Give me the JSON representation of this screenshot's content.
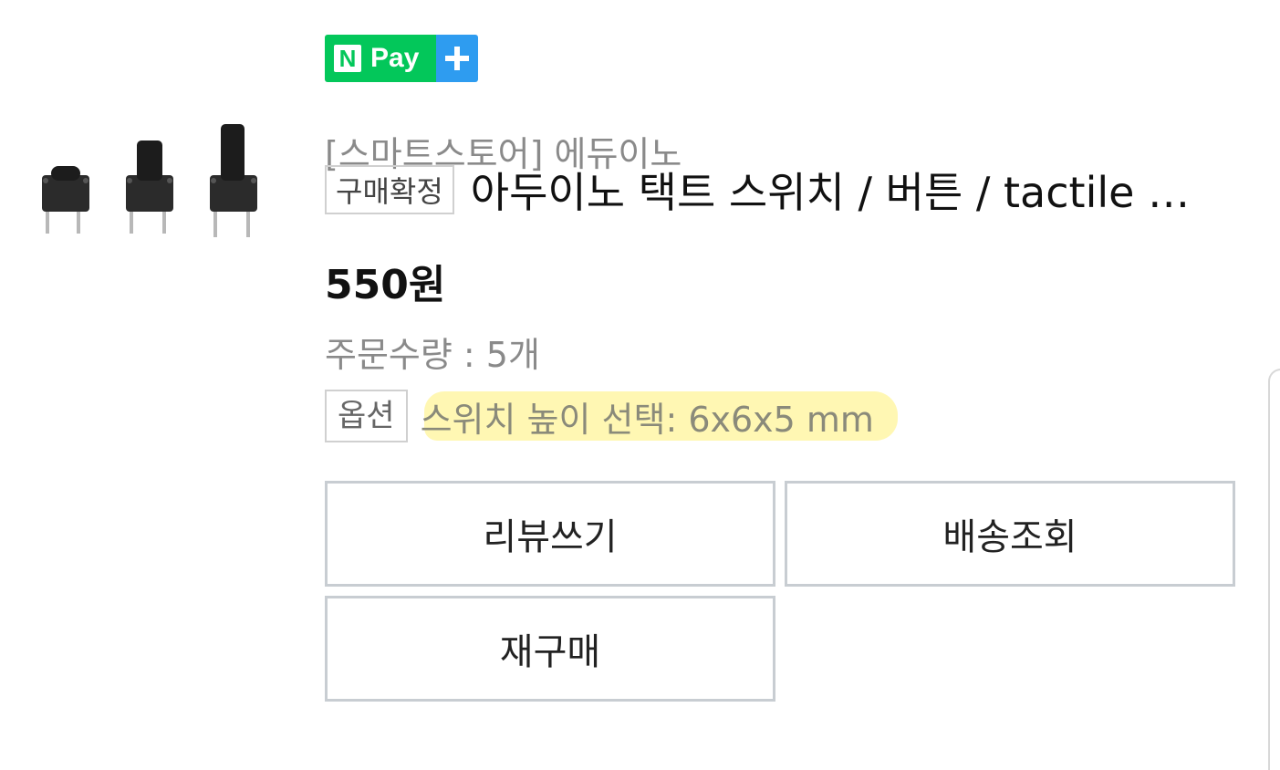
{
  "pay_badge": {
    "n_letter": "N",
    "text": "Pay",
    "plus_icon": "plus-icon",
    "colors": {
      "green": "#03c75a",
      "blue": "#2e9cf0"
    }
  },
  "store_name": "[스마트스토어] 에듀이노",
  "status_badge": "구매확정",
  "product_title": "아두이노 택트 스위치 / 버튼 / tactile switch",
  "price": "550원",
  "quantity": "주문수량 : 5개",
  "option_badge": "옵션",
  "option_text": "스위치 높이 선택: 6x6x5 mm",
  "buttons": {
    "review": "리뷰쓰기",
    "tracking": "배송조회",
    "rebuy": "재구매"
  }
}
